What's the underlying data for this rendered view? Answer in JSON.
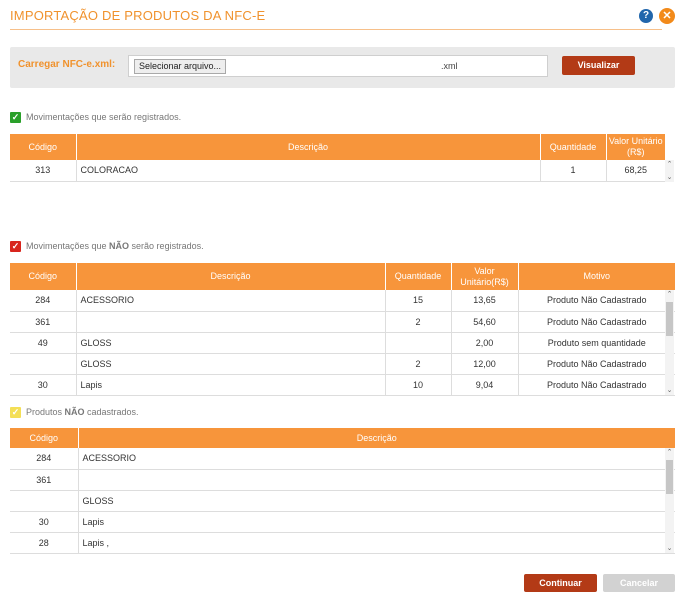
{
  "header": {
    "title": "IMPORTAÇÃO DE PRODUTOS DA NFC-E",
    "help_icon": "?",
    "close_icon": "✕"
  },
  "upload": {
    "label": "Carregar NFC-e.xml:",
    "file_button": "Selecionar arquivo...",
    "file_extension": ".xml",
    "view_button": "Visualizar"
  },
  "registered": {
    "label": "Movimentações que serão registrados.",
    "columns": [
      "Código",
      "Descrição",
      "Quantidade",
      "Valor Unitário (R$)"
    ],
    "rows": [
      [
        "313",
        "COLORACAO",
        "1",
        "68,25"
      ]
    ]
  },
  "not_registered": {
    "label_pre": "Movimentações que ",
    "label_bold": "NÃO",
    "label_post": " serão registrados.",
    "columns": [
      "Código",
      "Descrição",
      "Quantidade",
      "Valor Unitário(R$)",
      "Motivo"
    ],
    "rows": [
      [
        "284",
        "ACESSORIO",
        "15",
        "13,65",
        "Produto Não Cadastrado"
      ],
      [
        "361",
        "",
        "2",
        "54,60",
        "Produto Não Cadastrado"
      ],
      [
        "49",
        "GLOSS",
        "",
        "2,00",
        "Produto sem quantidade"
      ],
      [
        "",
        "GLOSS",
        "2",
        "12,00",
        "Produto Não Cadastrado"
      ],
      [
        "30",
        "Lapis",
        "10",
        "9,04",
        "Produto Não Cadastrado"
      ]
    ]
  },
  "products_not_registered": {
    "label_pre": "Produtos ",
    "label_bold": "NÃO",
    "label_post": " cadastrados.",
    "columns": [
      "Código",
      "Descrição"
    ],
    "rows": [
      [
        "284",
        "ACESSORIO"
      ],
      [
        "361",
        ""
      ],
      [
        "",
        "GLOSS"
      ],
      [
        "30",
        "Lapis"
      ],
      [
        "28",
        "Lapis ,"
      ]
    ]
  },
  "footer": {
    "continue_button": "Continuar",
    "cancel_button": "Cancelar"
  },
  "colors": {
    "accent": "#f0922d",
    "table_header": "#f7953b",
    "primary_button": "#b33a16",
    "disabled_button": "#d2d2d2",
    "check_green": "#2aa02a",
    "check_red": "#d8251d",
    "check_yellow": "#f4df56"
  }
}
